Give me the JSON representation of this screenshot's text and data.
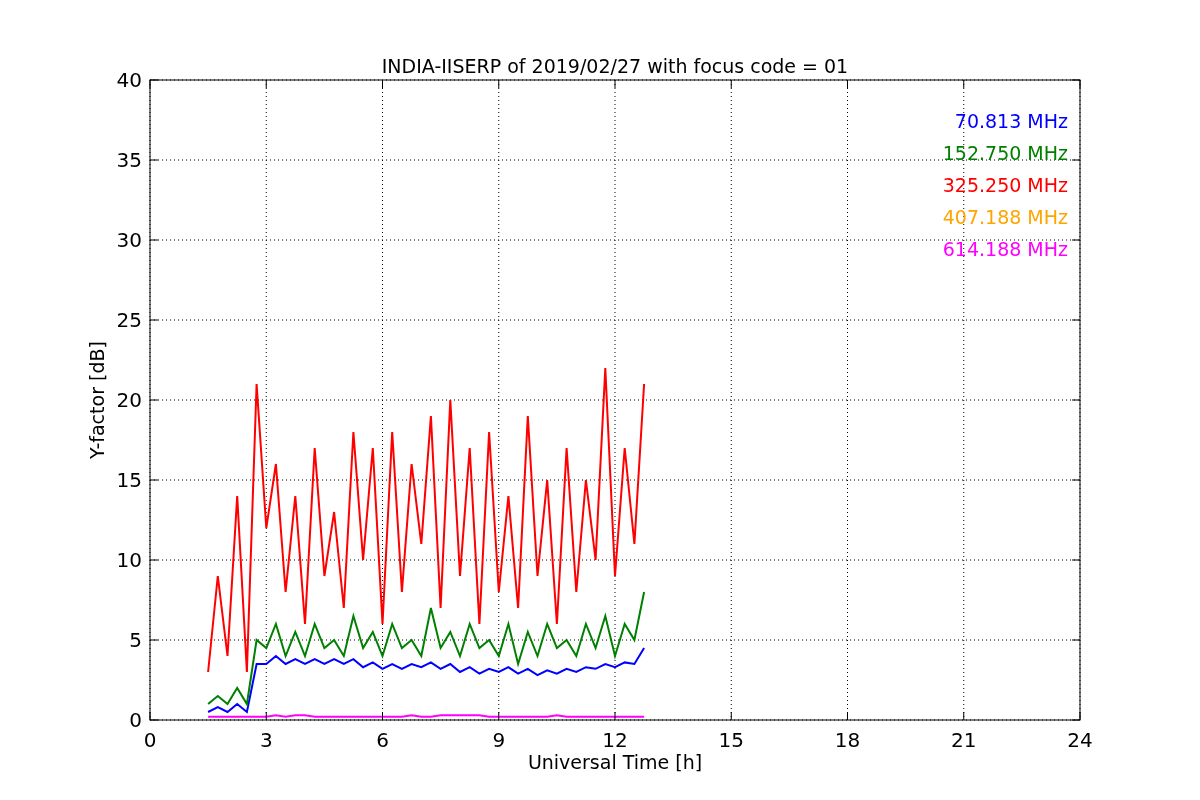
{
  "chart_data": {
    "type": "line",
    "title": "INDIA-IISERP of 2019/02/27 with focus code = 01",
    "xlabel": "Universal Time [h]",
    "ylabel": "Y-factor [dB]",
    "x": [
      1.5,
      1.75,
      2,
      2.25,
      2.5,
      2.75,
      3,
      3.25,
      3.5,
      3.75,
      4,
      4.25,
      4.5,
      4.75,
      5,
      5.25,
      5.5,
      5.75,
      6,
      6.25,
      6.5,
      6.75,
      7,
      7.25,
      7.5,
      7.75,
      8,
      8.25,
      8.5,
      8.75,
      9,
      9.25,
      9.5,
      9.75,
      10,
      10.25,
      10.5,
      10.75,
      11,
      11.25,
      11.5,
      11.75,
      12,
      12.25,
      12.5,
      12.75
    ],
    "series": [
      {
        "name": "70.813 MHz",
        "color": "#0000ff",
        "values": [
          0.5,
          0.8,
          0.5,
          1,
          0.5,
          3.5,
          3.5,
          4,
          3.5,
          3.8,
          3.5,
          3.8,
          3.5,
          3.8,
          3.5,
          3.8,
          3.3,
          3.6,
          3.2,
          3.5,
          3.2,
          3.5,
          3.3,
          3.6,
          3.2,
          3.5,
          3,
          3.3,
          2.9,
          3.2,
          3,
          3.3,
          2.9,
          3.2,
          2.8,
          3.1,
          2.9,
          3.2,
          3,
          3.3,
          3.2,
          3.5,
          3.3,
          3.6,
          3.5,
          4.5
        ]
      },
      {
        "name": "152.750 MHz",
        "color": "#008000",
        "values": [
          1,
          1.5,
          1,
          2,
          1,
          5,
          4.5,
          6,
          4,
          5.5,
          4,
          6,
          4.5,
          5,
          4,
          6.5,
          4.5,
          5.5,
          4,
          6,
          4.5,
          5,
          4,
          7,
          4.5,
          5.5,
          4,
          6,
          4.5,
          5,
          4,
          6,
          3.5,
          5.5,
          4,
          6,
          4.5,
          5,
          4,
          6,
          4.5,
          6.5,
          4,
          6,
          5,
          8
        ]
      },
      {
        "name": "325.250 MHz",
        "color": "#ff0000",
        "values": [
          3,
          9,
          4,
          14,
          3,
          21,
          12,
          16,
          8,
          14,
          6,
          17,
          9,
          13,
          7,
          18,
          10,
          17,
          6,
          18,
          8,
          16,
          11,
          19,
          7,
          20,
          9,
          17,
          6,
          18,
          8,
          14,
          7,
          19,
          9,
          15,
          6,
          17,
          8,
          15,
          10,
          22,
          9,
          17,
          11,
          21
        ]
      },
      {
        "name": "407.188 MHz",
        "color": "#ffa500",
        "values": [
          null,
          null,
          null,
          null,
          null,
          null,
          null,
          null,
          null,
          null,
          null,
          null,
          null,
          null,
          null,
          null,
          null,
          null,
          null,
          null,
          null,
          null,
          null,
          null,
          null,
          null,
          null,
          null,
          null,
          null,
          null,
          null,
          null,
          null,
          null,
          null,
          null,
          null,
          null,
          null,
          null,
          null,
          null,
          null,
          null,
          null
        ]
      },
      {
        "name": "614.188 MHz",
        "color": "#ff00ff",
        "values": [
          0.2,
          0.2,
          0.2,
          0.2,
          0.2,
          0.2,
          0.2,
          0.3,
          0.2,
          0.3,
          0.3,
          0.2,
          0.2,
          0.2,
          0.2,
          0.2,
          0.2,
          0.2,
          0.2,
          0.2,
          0.2,
          0.3,
          0.2,
          0.2,
          0.3,
          0.3,
          0.3,
          0.3,
          0.3,
          0.2,
          0.2,
          0.2,
          0.2,
          0.2,
          0.2,
          0.2,
          0.3,
          0.2,
          0.2,
          0.2,
          0.2,
          0.2,
          0.2,
          0.2,
          0.2,
          0.2
        ]
      }
    ],
    "grid": true,
    "xlim": [
      0,
      24
    ],
    "ylim": [
      0,
      40
    ],
    "xticks": [
      0,
      3,
      6,
      9,
      12,
      15,
      18,
      21,
      24
    ],
    "yticks": [
      0,
      5,
      10,
      15,
      20,
      25,
      30,
      35,
      40
    ]
  }
}
